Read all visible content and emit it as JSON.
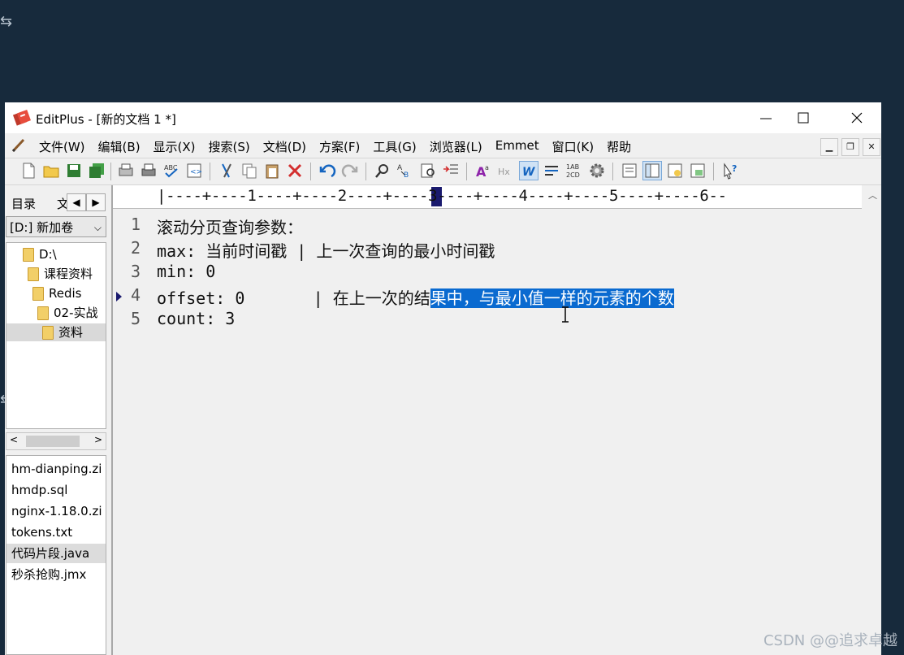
{
  "window": {
    "title": "EditPlus - [新的文档 1 *]"
  },
  "menu": {
    "items": [
      "文件(W)",
      "编辑(B)",
      "显示(X)",
      "搜索(S)",
      "文档(D)",
      "方案(F)",
      "工具(G)",
      "浏览器(L)",
      "Emmet",
      "窗口(K)",
      "帮助"
    ]
  },
  "sidebar": {
    "tab_directory": "目录",
    "tab_text": "文",
    "drive": "[D:] 新加卷",
    "tree": [
      "D:\\",
      "课程资料",
      "Redis",
      "02-实战",
      "资料"
    ],
    "files": [
      "hm-dianping.zi",
      "hmdp.sql",
      "nginx-1.18.0.zi",
      "tokens.txt",
      "代码片段.java",
      "秒杀抢购.jmx"
    ]
  },
  "ruler": {
    "text": "|----+----1----+----2----+----3----+----4----+----5----+----6--"
  },
  "editor": {
    "lines": [
      {
        "num": "1",
        "text": "滚动分页查询参数：",
        "selected": ""
      },
      {
        "num": "2",
        "text": "max: 当前时间戳 | 上一次查询的最小时间戳",
        "selected": ""
      },
      {
        "num": "3",
        "text": "min: 0",
        "selected": ""
      },
      {
        "num": "4",
        "text": "offset: 0       | 在上一次的结",
        "selected": "果中，与最小值一样的元素的个数"
      },
      {
        "num": "5",
        "text": "count: 3",
        "selected": ""
      }
    ],
    "current_line": 4
  },
  "watermark": "CSDN @@追求卓越",
  "colors": {
    "background": "#172a3c",
    "selection": "#0a6ad0",
    "window": "#f0f0f0"
  }
}
